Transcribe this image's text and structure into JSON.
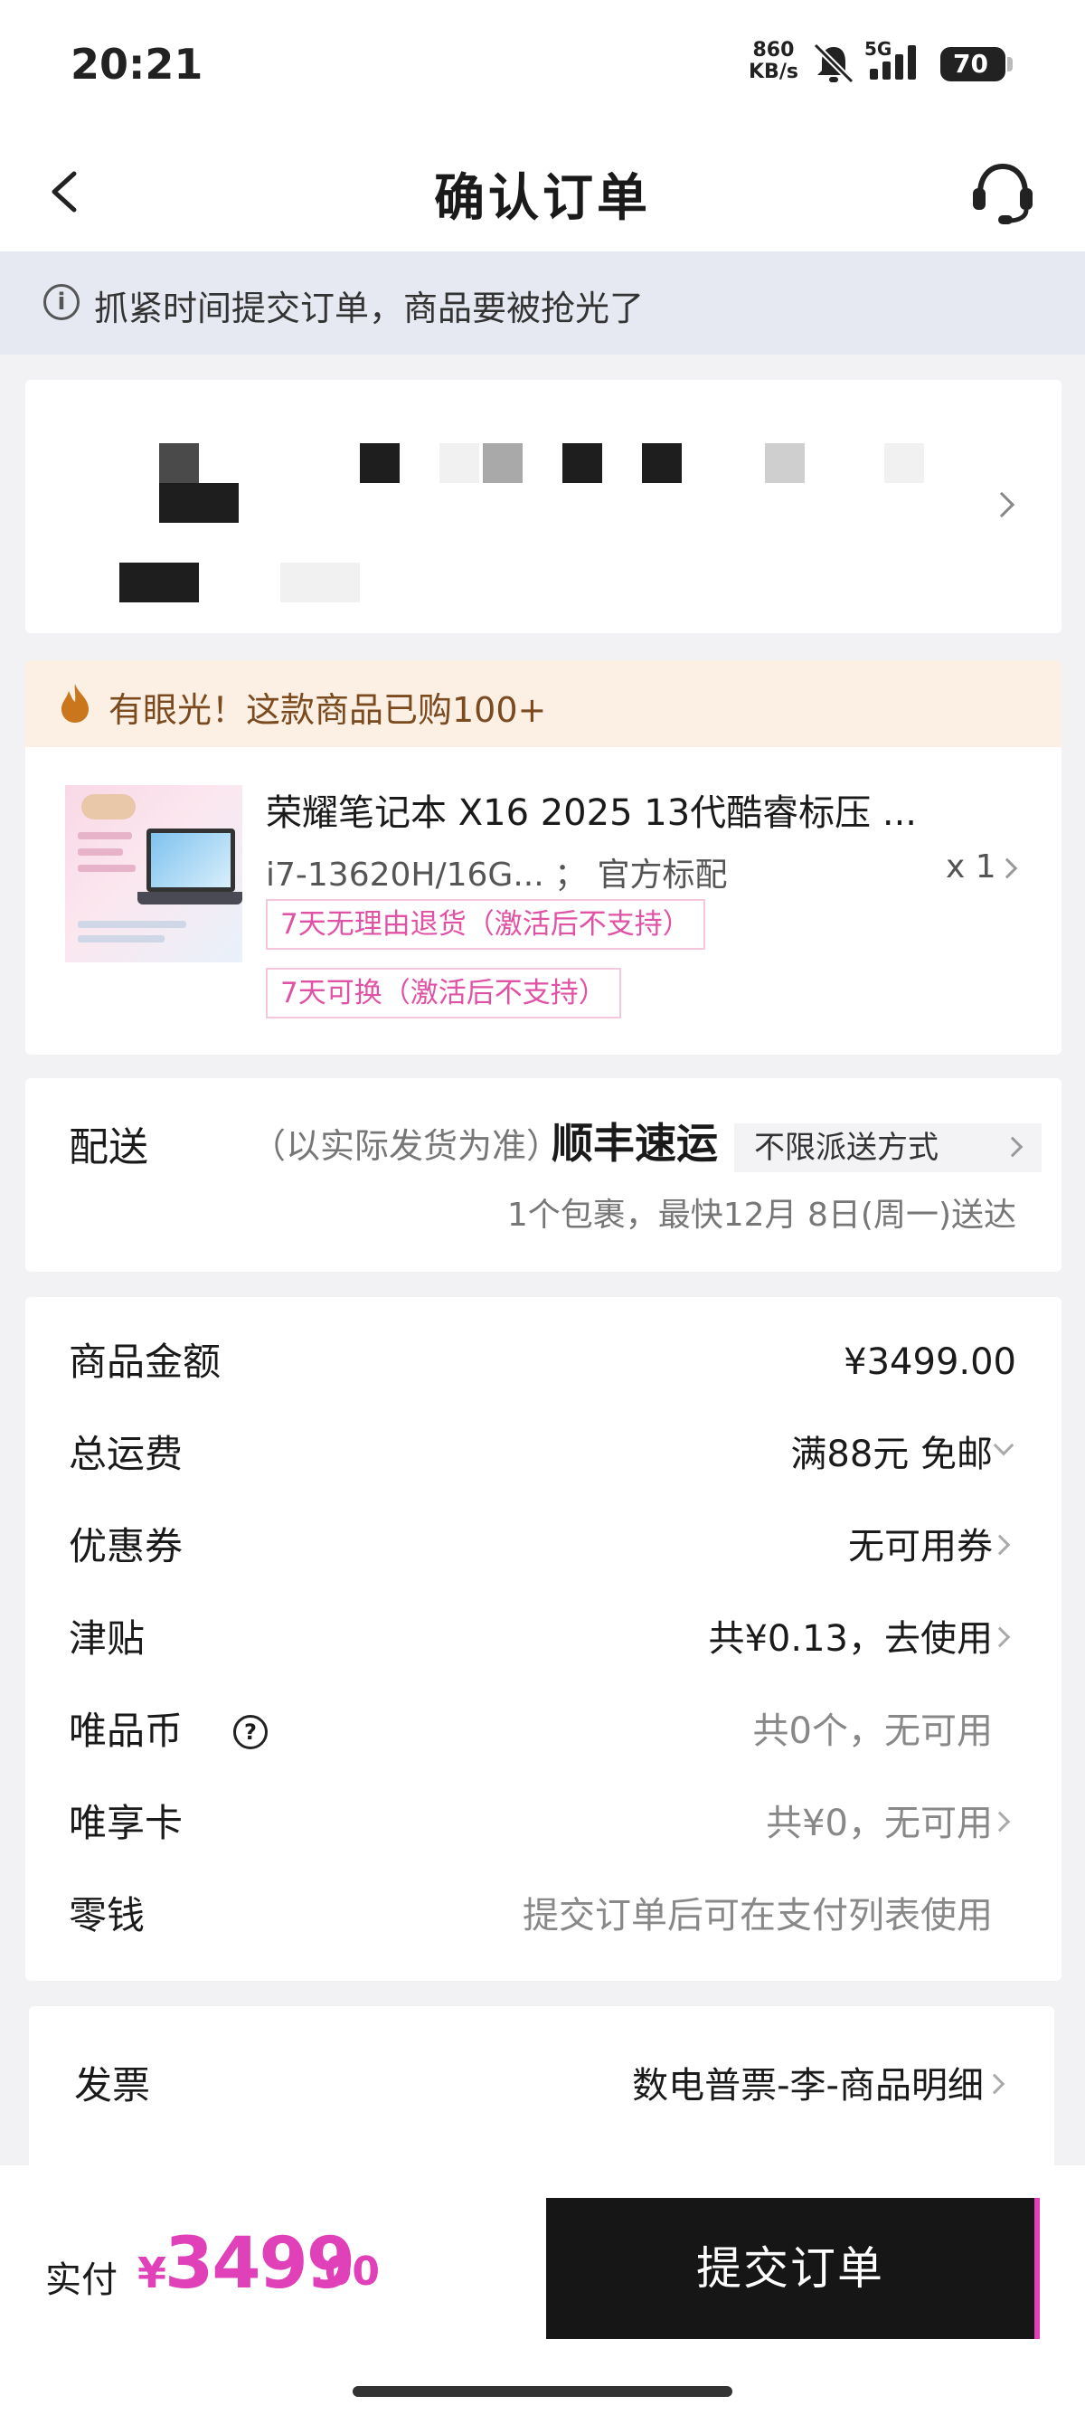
{
  "status_bar": {
    "time": "20:21",
    "net_speed_value": "860",
    "net_speed_unit": "KB/s",
    "network": "5G",
    "battery": "70"
  },
  "header": {
    "title": "确认订单",
    "back_icon": "back-chevron-icon",
    "support_icon": "headset-icon"
  },
  "notice": {
    "icon": "info-icon",
    "text": "抓紧时间提交订单，商品要被抢光了"
  },
  "product": {
    "banner_icon": "flame-icon",
    "banner_text": "有眼光！这款商品已购100+",
    "name": "荣耀笔记本 X16 2025  13代酷睿标压 ...",
    "spec": "i7-13620H/16G...  ；  官方标配",
    "quantity": "x 1",
    "tags": [
      "7天无理由退货（激活后不支持）",
      "7天可换（激活后不支持）"
    ]
  },
  "delivery": {
    "label": "配送",
    "note": "（以实际发货为准）",
    "carrier": "顺丰速运",
    "option": "不限派送方式",
    "estimate": "1个包裹，最快12月 8日(周一)送达"
  },
  "fees": {
    "rows": [
      {
        "label": "商品金额",
        "value": "¥3499.00"
      },
      {
        "label": "总运费",
        "value": "满88元 免邮"
      },
      {
        "label": "优惠券",
        "value": "无可用券"
      },
      {
        "label": "津贴",
        "value": "共¥0.13，去使用"
      },
      {
        "label": "唯品币",
        "value": "共0个，无可用"
      },
      {
        "label": "唯享卡",
        "value": "共¥0，无可用"
      },
      {
        "label": "零钱",
        "value": "提交订单后可在支付列表使用"
      }
    ]
  },
  "invoice": {
    "label": "发票",
    "value": "数电普票-李-商品明细"
  },
  "footer": {
    "pay_label": "实付",
    "currency": "¥",
    "amount_int": "3499",
    "amount_dec": ".00",
    "submit_label": "提交订单"
  },
  "colors": {
    "accent_pink": "#e040b8",
    "tag_pink": "#e052a5",
    "notice_bg": "#e6e9f2",
    "banner_bg": "#fbf0e3"
  }
}
